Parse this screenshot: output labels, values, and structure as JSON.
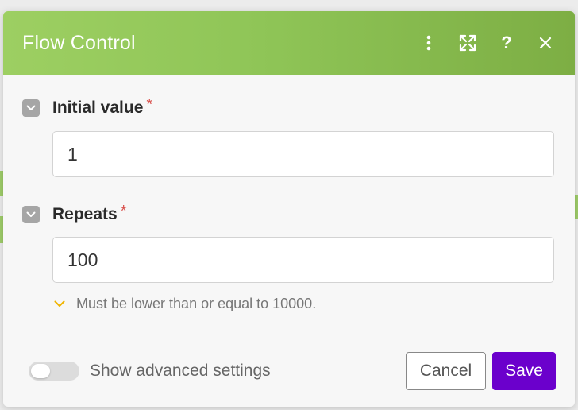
{
  "modal": {
    "title": "Flow Control",
    "header_icons": [
      "more-vertical-icon",
      "expand-icon",
      "help-icon",
      "close-icon"
    ],
    "help_glyph": "?"
  },
  "fields": [
    {
      "label": "Initial value",
      "required_mark": "*",
      "value": "1"
    },
    {
      "label": "Repeats",
      "required_mark": "*",
      "value": "100"
    }
  ],
  "repeats_hint": "Must be lower than or equal to 10000.",
  "footer": {
    "toggle_label": "Show advanced settings",
    "toggle_on": false,
    "cancel_label": "Cancel",
    "save_label": "Save"
  },
  "colors": {
    "header_green": "#8fc557",
    "save_purple": "#6b00cc",
    "required_red": "#d9534f",
    "hint_chevron": "#f0b400"
  }
}
